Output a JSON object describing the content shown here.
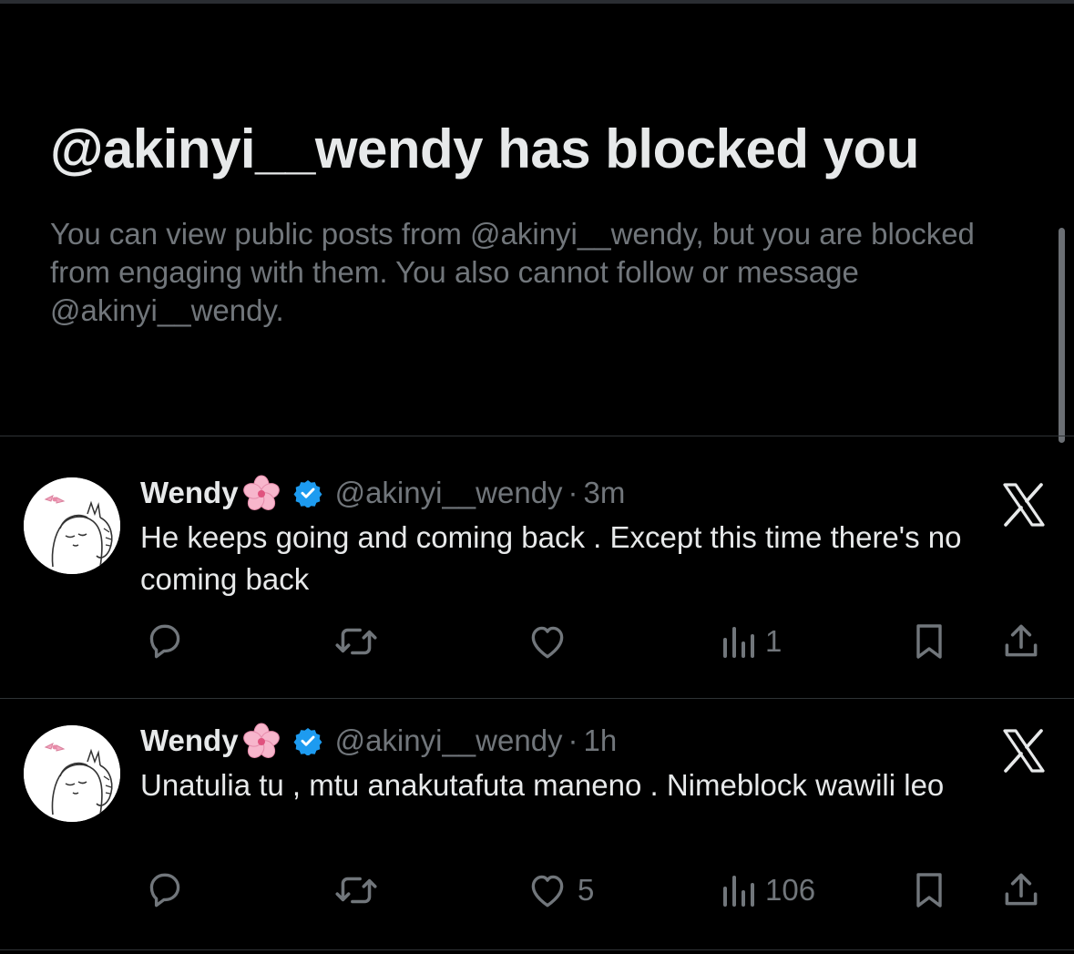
{
  "blocked": {
    "title": "@akinyi__wendy has blocked you",
    "description": "You can view public posts from @akinyi__wendy, but you are blocked from engaging with them. You also cannot follow or message @akinyi__wendy."
  },
  "tweets": [
    {
      "display_name": "Wendy",
      "handle": "@akinyi__wendy",
      "separator": "·",
      "time": "3m",
      "text": "He keeps going and coming back . Except this time there's no coming back",
      "reply_count": "",
      "retweet_count": "",
      "like_count": "",
      "view_count": "1"
    },
    {
      "display_name": "Wendy",
      "handle": "@akinyi__wendy",
      "separator": "·",
      "time": "1h",
      "text": "Unatulia tu , mtu anakutafuta maneno . Nimeblock wawili leo",
      "reply_count": "",
      "retweet_count": "",
      "like_count": "5",
      "view_count": "106"
    }
  ],
  "icons": {
    "flower": "cherry-blossom-icon",
    "verified": "verified-badge-icon",
    "brand": "x-logo-icon",
    "reply": "reply-icon",
    "retweet": "retweet-icon",
    "like": "heart-icon",
    "views": "views-icon",
    "bookmark": "bookmark-icon",
    "share": "share-icon"
  },
  "colors": {
    "background": "#000000",
    "primary_text": "#e7e9ea",
    "secondary_text": "#71767b",
    "divider": "#2f3336",
    "verified": "#1d9bf0"
  }
}
